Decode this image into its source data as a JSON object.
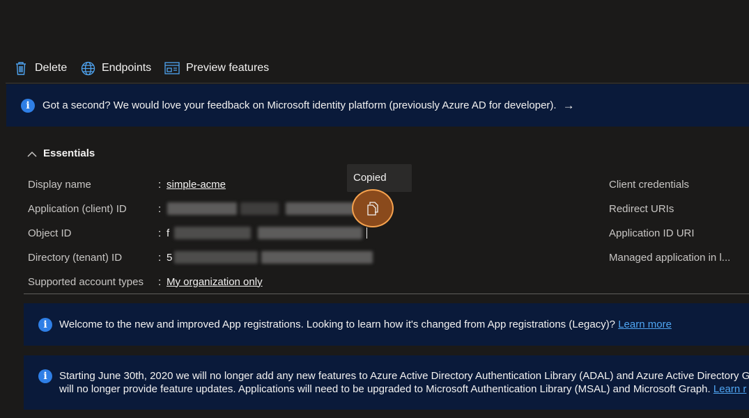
{
  "toolbar": {
    "delete_label": "Delete",
    "endpoints_label": "Endpoints",
    "preview_label": "Preview features"
  },
  "feedback_banner": {
    "text": "Got a second? We would love your feedback on Microsoft identity platform (previously Azure AD for developer).",
    "arrow": "→"
  },
  "essentials": {
    "title": "Essentials",
    "rows": [
      {
        "label": "Display name",
        "colon": ":",
        "value": "simple-acme"
      },
      {
        "label": "Application (client) ID",
        "colon": ":",
        "value": ""
      },
      {
        "label": "Object ID",
        "colon": ":",
        "value": "f"
      },
      {
        "label": "Directory (tenant) ID",
        "colon": ":",
        "value": "5"
      },
      {
        "label": "Supported account types",
        "colon": ":",
        "value": "My organization only"
      }
    ],
    "right_labels": [
      "Client credentials",
      "Redirect URIs",
      "Application ID URI",
      "Managed application in l..."
    ]
  },
  "tooltip": {
    "text": "Copied"
  },
  "welcome_banner": {
    "text": "Welcome to the new and improved App registrations. Looking to learn how it's changed from App registrations (Legacy)?",
    "link": "Learn more"
  },
  "adal_banner": {
    "line1": "Starting June 30th, 2020 we will no longer add any new features to Azure Active Directory Authentication Library (ADAL) and Azure Active Directory Gr",
    "line2": "will no longer provide feature updates. Applications will need to be upgraded to Microsoft Authentication Library (MSAL) and Microsoft Graph.",
    "link": "Learn r"
  },
  "icons": [
    "trash-icon",
    "globe-icon",
    "preview-features-icon",
    "info-icon",
    "chevron-up-icon",
    "copy-icon",
    "arrow-right-icon"
  ],
  "colors": {
    "accent": "#4fa5f2",
    "banner_bg": "#0a1a3a",
    "info_blue": "#2f7fe6",
    "highlight_orange": "#f6a24e"
  }
}
